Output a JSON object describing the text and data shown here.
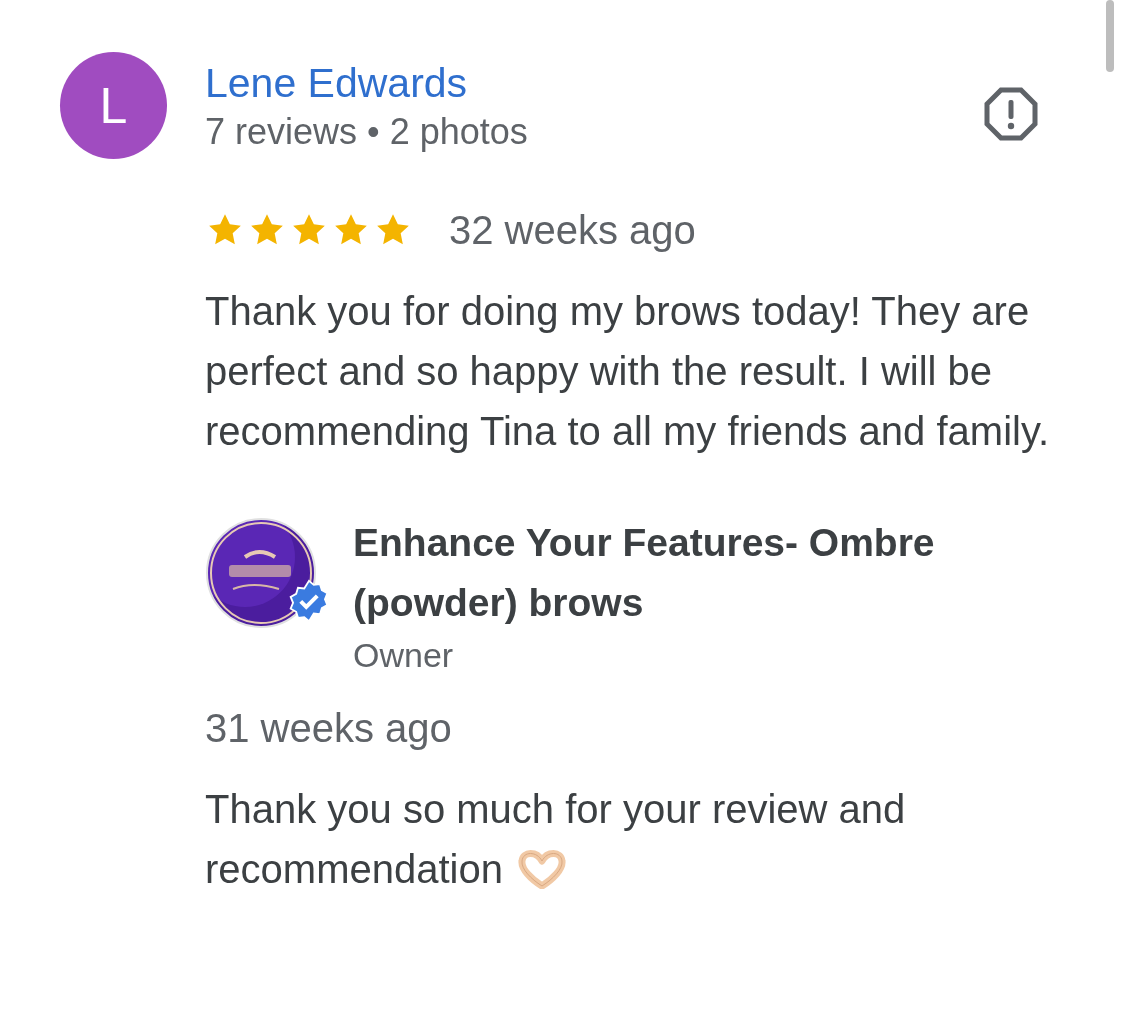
{
  "review": {
    "avatar_letter": "L",
    "author": "Lene Edwards",
    "author_meta": "7 reviews • 2 photos",
    "stars": 5,
    "time": "32 weeks ago",
    "text": "Thank you for doing my brows today! They are perfect and so happy with the result. I will be recommending Tina to all my friends and family."
  },
  "owner_reply": {
    "logo": {
      "kind": "picture",
      "verified": true
    },
    "name": "Enhance Your Features- Ombre (powder) brows",
    "role": "Owner",
    "time": "31 weeks ago",
    "text": "Thank you so much for your review and recommendation"
  }
}
